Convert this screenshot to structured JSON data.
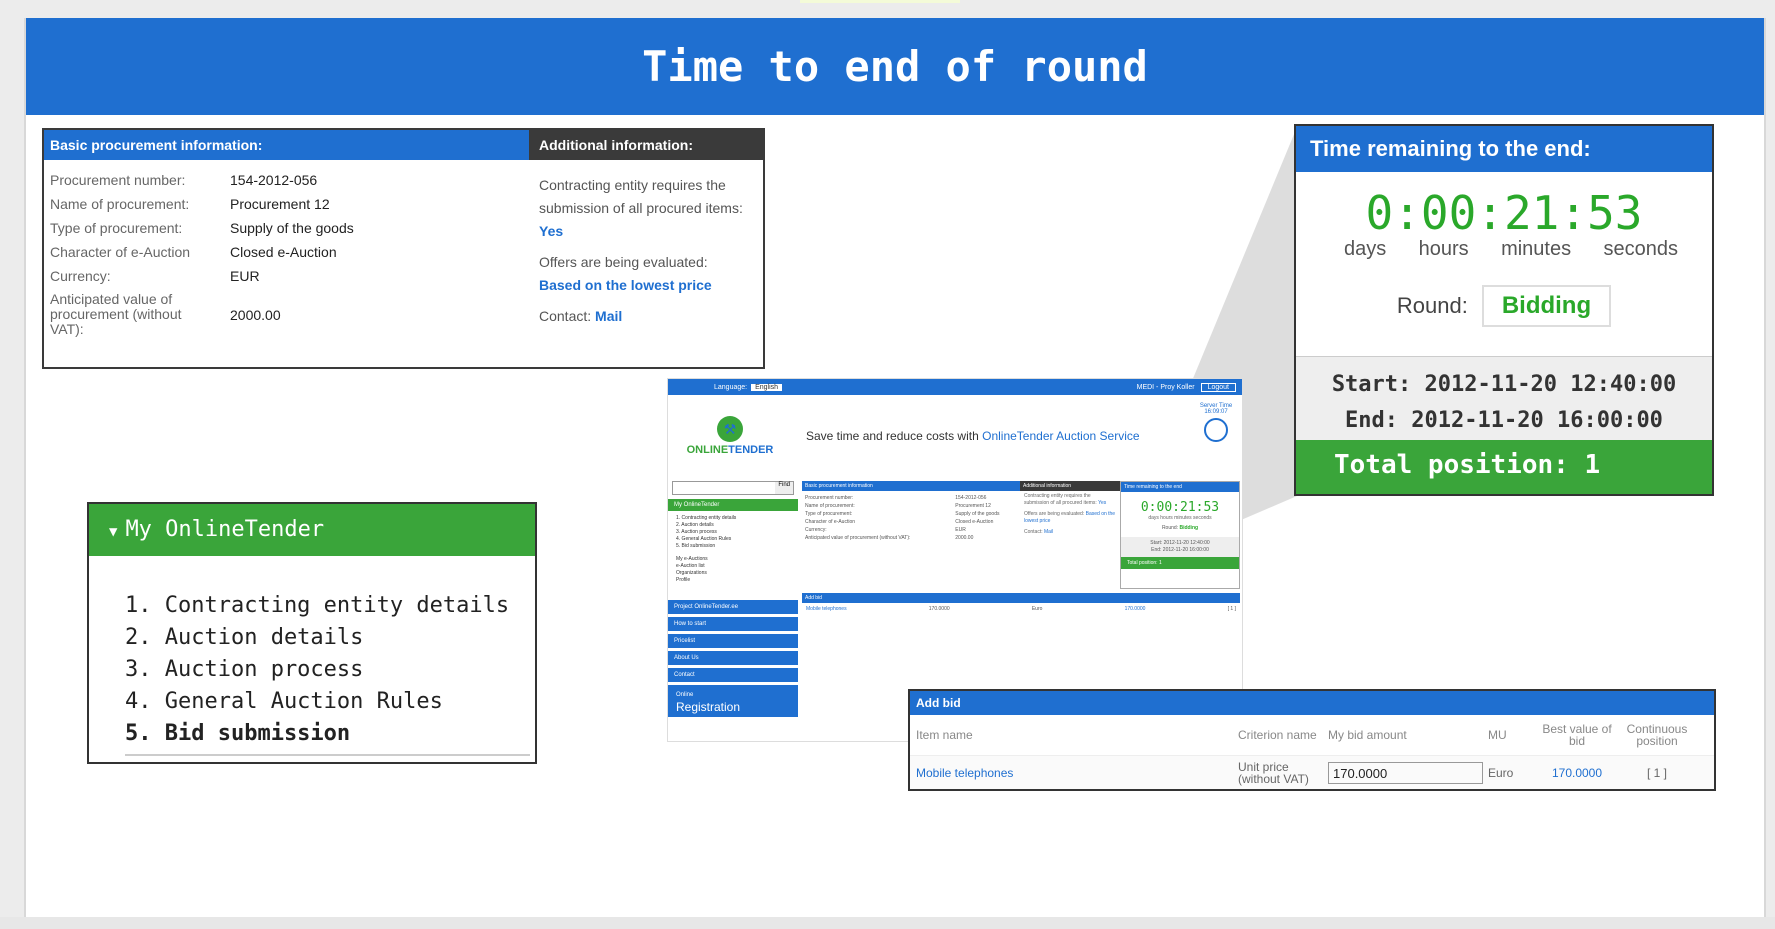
{
  "slide": {
    "title": "Time to end of round"
  },
  "procurement": {
    "basic_header": "Basic procurement information:",
    "additional_header": "Additional information:",
    "rows": [
      {
        "label": "Procurement number:",
        "value": "154-2012-056"
      },
      {
        "label": "Name of procurement:",
        "value": "Procurement 12"
      },
      {
        "label": "Type of procurement:",
        "value": "Supply of the goods"
      },
      {
        "label": "Character of e-Auction",
        "value": "Closed e-Auction"
      },
      {
        "label": "Currency:",
        "value": "EUR"
      },
      {
        "label": "Anticipated value of procurement (without VAT):",
        "value": "2000.00"
      }
    ],
    "additional": {
      "submission_text": "Contracting entity requires the submission of all procured items:",
      "submission_value": "Yes",
      "evaluation_text": "Offers are being evaluated:",
      "evaluation_value": "Based on the lowest price",
      "contact_label": "Contact:",
      "contact_value": "Mail"
    }
  },
  "timer": {
    "header": "Time remaining to the end:",
    "clock": "0:00:21:53",
    "units": [
      "days",
      "hours",
      "minutes",
      "seconds"
    ],
    "round_label": "Round:",
    "round_value": "Bidding",
    "start": "Start: 2012-11-20 12:40:00",
    "end": "End: 2012-11-20 16:00:00",
    "total_position": "Total position: 1"
  },
  "menu": {
    "header": "My OnlineTender",
    "items": [
      "1. Contracting entity details",
      "2. Auction details",
      "3. Auction process",
      "4. General Auction Rules",
      "5. Bid submission"
    ]
  },
  "thumbnail": {
    "language_label": "Language:",
    "language_value": "English",
    "user": "MEDI - Proy Koller",
    "logout": "Logout",
    "logo_online": "ONLINE",
    "logo_tender": "TENDER",
    "slogan": "Save time and reduce costs with",
    "slogan_link": "OnlineTender Auction Service",
    "server_time": "Server Time 16:09:07",
    "search_button": "Find",
    "side_items": [
      "My OnlineTender",
      "Project OnlineTender.ee",
      "How to start",
      "Pricelist",
      "About Us",
      "Contact"
    ],
    "side_sub": [
      "1. Contracting entity details",
      "2. Auction details",
      "3. Auction process",
      "4. General Auction Rules",
      "5. Bid submission",
      "My e-Auctions",
      "e-Auction list",
      "Organizations",
      "Profile"
    ],
    "online_label": "Online",
    "registration": "Registration",
    "basic_header": "Basic procurement information",
    "additional_header": "Additional information",
    "time_header": "Time remaining to the end",
    "clock": "0:00:21:53",
    "units": "days hours minutes seconds",
    "round_label": "Round:",
    "round_value": "Bidding",
    "start": "Start: 2012-11-20 12:40:00",
    "end": "End: 2012-11-20 16:00:00",
    "total": "Total position: 1",
    "add_bid": "Add bid",
    "bid_item": "Mobile telephones",
    "bid_amount": "170.0000",
    "bid_mu": "Euro",
    "bid_best": "170.0000",
    "bid_pos": "[ 1 ]"
  },
  "bid": {
    "header": "Add bid",
    "columns": [
      "Item name",
      "Criterion name",
      "My bid amount",
      "MU",
      "Best value of bid",
      "Continuous position"
    ],
    "row": {
      "item": "Mobile telephones",
      "criterion": "Unit price (without VAT)",
      "amount": "170.0000",
      "mu": "Euro",
      "best": "170.0000",
      "position": "[ 1 ]"
    }
  },
  "colors": {
    "brand_blue": "#1f6fd0",
    "brand_green": "#3aa53a",
    "timer_green": "#2aa82a",
    "dark_header": "#3a3a3a"
  }
}
